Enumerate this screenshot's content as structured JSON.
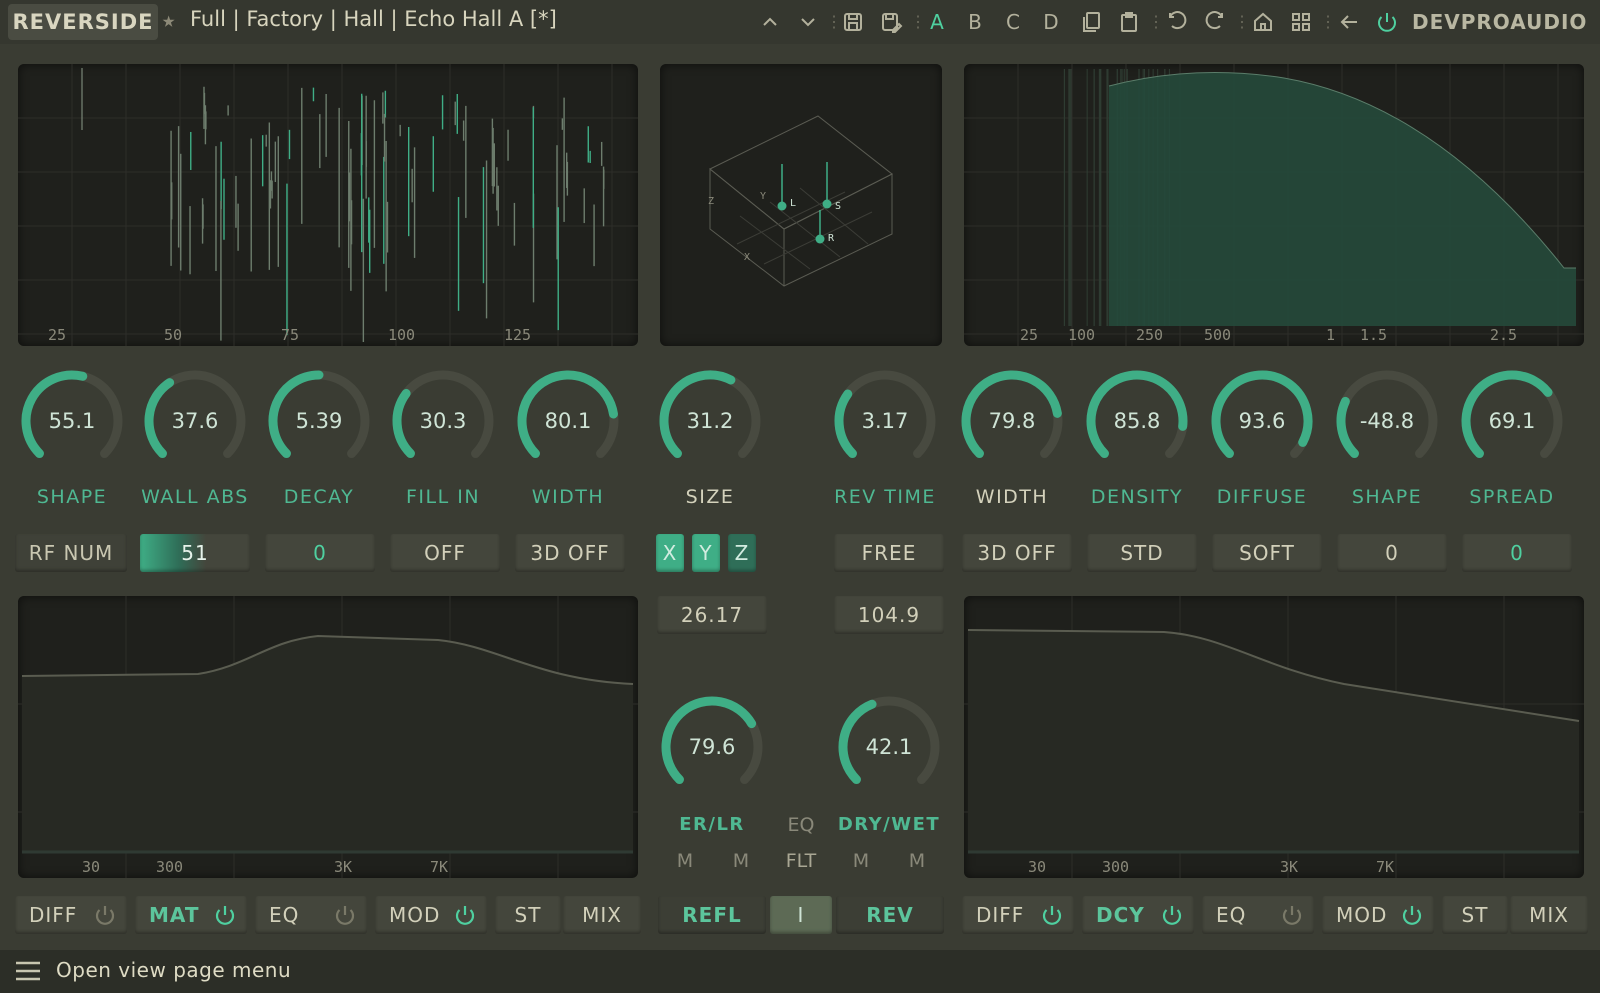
{
  "header": {
    "logo": "REVERSIDE",
    "preset": "Full | Factory | Hall | Echo Hall A [*]",
    "slots": [
      "A",
      "B",
      "C",
      "D"
    ],
    "brand": "DEVPROAUDIO",
    "icons": [
      "chevron-up-icon",
      "chevron-down-icon",
      "save-icon",
      "save-as-icon",
      "copy-icon",
      "paste-icon",
      "undo-icon",
      "redo-icon",
      "home-icon",
      "grid-icon",
      "back-arrow-icon",
      "power-icon"
    ]
  },
  "er_panel": {
    "axis": [
      "25",
      "50",
      "75",
      "100",
      "125"
    ]
  },
  "room_panel": {
    "axis_labels": [
      "Z",
      "Y",
      "X"
    ],
    "points": [
      "L",
      "S",
      "R"
    ]
  },
  "decay_panel": {
    "axis": [
      "25",
      "100",
      "250",
      "500",
      "1",
      "1.5",
      "2.5"
    ]
  },
  "knobs": [
    {
      "value": "55.1",
      "label": "SHAPE",
      "fraction": 0.55
    },
    {
      "value": "37.6",
      "label": "WALL ABS",
      "fraction": 0.376
    },
    {
      "value": "5.39",
      "label": "DECAY",
      "fraction": 0.5
    },
    {
      "value": "30.3",
      "label": "FILL IN",
      "fraction": 0.303
    },
    {
      "value": "80.1",
      "label": "WIDTH",
      "fraction": 0.801
    },
    {
      "value": "31.2",
      "label": "SIZE",
      "fraction": 0.6
    },
    {
      "value": "3.17",
      "label": "REV TIME",
      "fraction": 0.3
    },
    {
      "value": "79.8",
      "label": "WIDTH",
      "fraction": 0.798
    },
    {
      "value": "85.8",
      "label": "DENSITY",
      "fraction": 0.858
    },
    {
      "value": "93.6",
      "label": "DIFFUSE",
      "fraction": 0.936
    },
    {
      "value": "-48.8",
      "label": "SHAPE",
      "fraction": 0.26
    },
    {
      "value": "69.1",
      "label": "SPREAD",
      "fraction": 0.691
    }
  ],
  "controls": {
    "rf_num_label": "RF NUM",
    "rf_num_value": "51",
    "c1": "0",
    "c2": "OFF",
    "c3": "3D OFF",
    "x": "X",
    "y": "Y",
    "z": "Z",
    "free": "FREE",
    "c4": "3D OFF",
    "std": "STD",
    "soft": "SOFT",
    "c5": "0",
    "c6": "0",
    "size_readout": "26.17",
    "rev_readout": "104.9"
  },
  "eq_left": {
    "axis": [
      "30",
      "300",
      "3K",
      "7K"
    ]
  },
  "eq_right": {
    "axis": [
      "30",
      "300",
      "3K",
      "7K"
    ]
  },
  "center": {
    "knob1": {
      "value": "79.6",
      "label": "ER/LR",
      "fraction": 0.72
    },
    "knob2": {
      "value": "42.1",
      "label": "DRY/WET",
      "fraction": 0.42
    },
    "eq_label": "EQ",
    "flt_label": "FLT",
    "m": "M",
    "refl": "REFL",
    "divider": "I",
    "rev": "REV"
  },
  "bottom_left": [
    "DIFF",
    "MAT",
    "EQ",
    "MOD",
    "ST",
    "MIX"
  ],
  "bottom_right": [
    "DIFF",
    "DCY",
    "EQ",
    "MOD",
    "ST",
    "MIX"
  ],
  "menu": {
    "label": "Open view page menu"
  },
  "colors": {
    "accent": "#3fae86",
    "panel": "#1f201c",
    "bg": "#3a3c33"
  }
}
